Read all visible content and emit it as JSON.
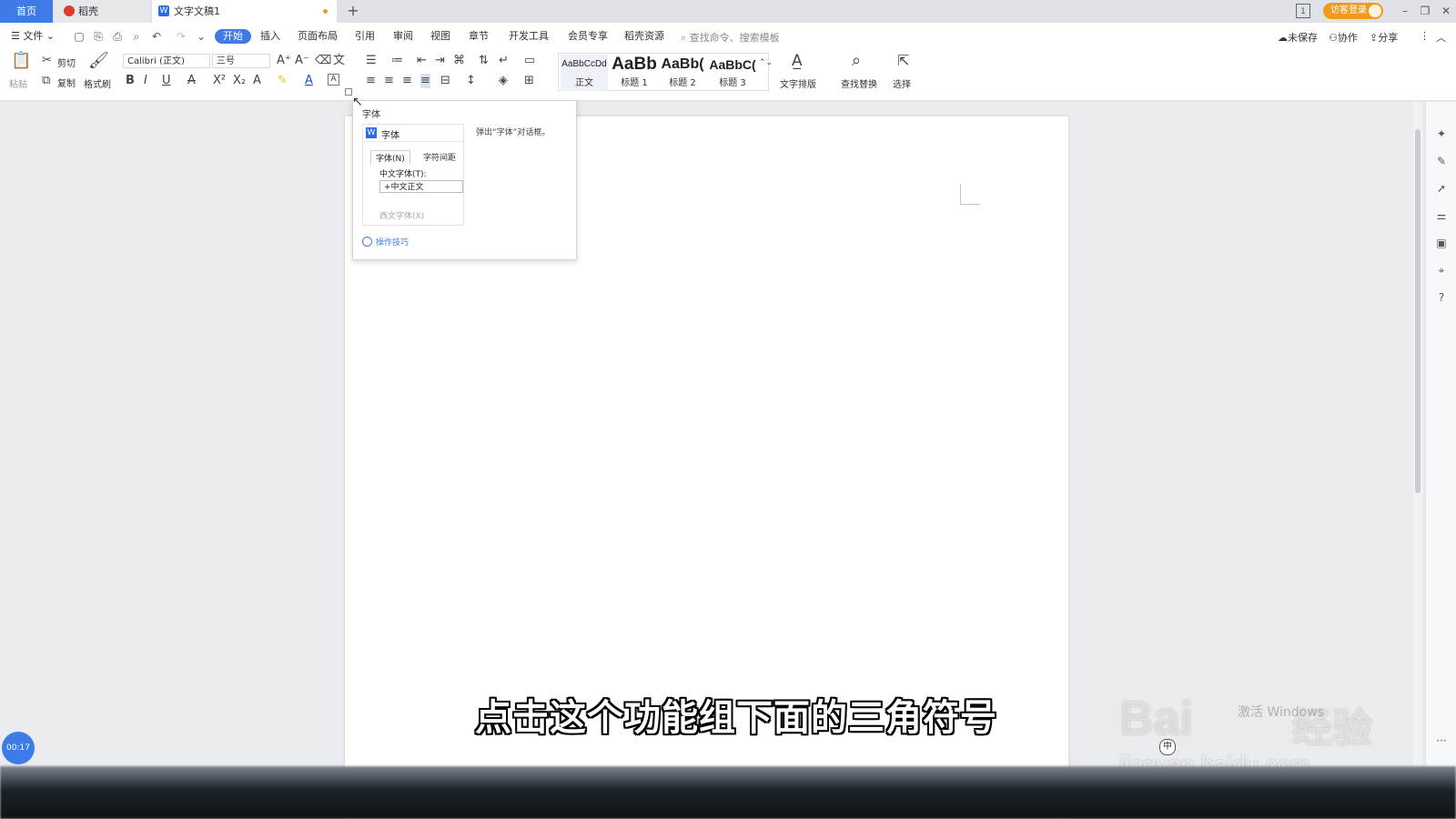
{
  "tabs": {
    "home": "首页",
    "daoke": "稻壳",
    "doc": "文字文稿1",
    "new": "+"
  },
  "titlebar": {
    "login": "访客登录",
    "window_controls": [
      "1",
      "–",
      "❐",
      "✕"
    ]
  },
  "menubar": {
    "file": "文件",
    "items": [
      "开始",
      "插入",
      "页面布局",
      "引用",
      "审阅",
      "视图",
      "章节",
      "开发工具",
      "会员专享",
      "稻壳资源"
    ],
    "search_placeholder": "查找命令、搜索模板",
    "right_items": [
      "未保存",
      "协作",
      "分享"
    ]
  },
  "ribbon": {
    "paste": "粘贴",
    "cut": "剪切",
    "copy": "复制",
    "format_painter": "格式刷",
    "font_name": "Calibri (正文)",
    "font_size": "三号",
    "styles": [
      {
        "sample": "AaBbCcDd",
        "label": "正文"
      },
      {
        "sample": "AaBb",
        "label": "标题 1"
      },
      {
        "sample": "AaBb(",
        "label": "标题 2"
      },
      {
        "sample": "AaBbC(",
        "label": "标题 3"
      }
    ],
    "text_layout": "文字排版",
    "find_replace": "查找替换",
    "select": "选择"
  },
  "tooltip": {
    "title": "字体",
    "preview_title": "字体",
    "tab1": "字体(N)",
    "tab2": "字符间距",
    "field_label": "中文字体(T):",
    "field_value": "+中文正文",
    "field2_label": "西文字体(X)",
    "description": "弹出“字体”对话框。",
    "tips_link": "操作技巧"
  },
  "subtitle": "点击这个功能组下面的三角符号",
  "watermark": {
    "logo": "Bai",
    "logo2": "经验",
    "url": "jingyan.baidu.com",
    "activate": "激活 Windows"
  },
  "timer": "00:17",
  "ime": "中"
}
